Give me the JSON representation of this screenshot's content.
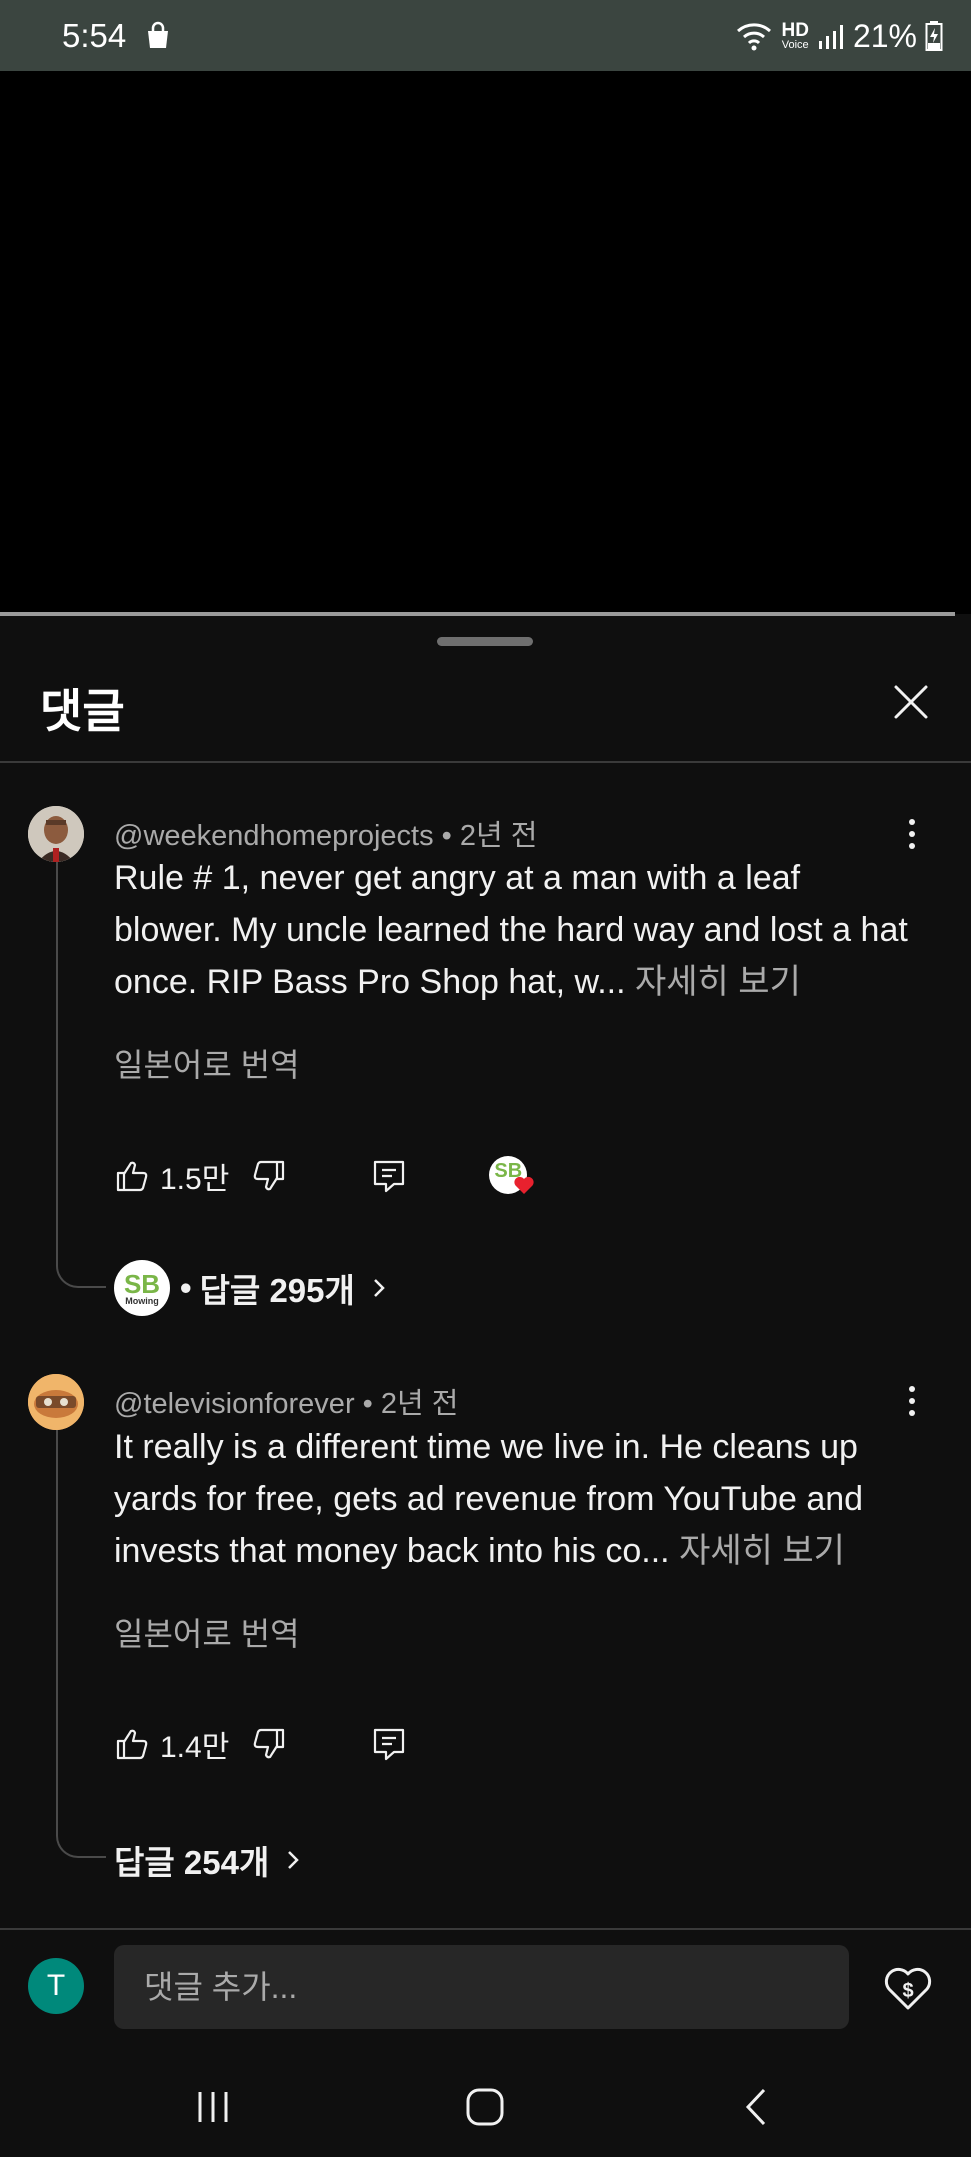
{
  "status_bar": {
    "time": "5:54",
    "battery": "21%",
    "network": "HD",
    "network_sub": "Voice"
  },
  "sheet": {
    "title": "댓글"
  },
  "comments": [
    {
      "handle": "@weekendhomeprojects",
      "age": "2년 전",
      "text": "Rule # 1, never get angry at a man with a leaf blower.  My uncle learned the hard way and lost a hat once.  RIP Bass Pro Shop hat, w...",
      "more": "자세히 보기",
      "translate": "일본어로 번역",
      "likes": "1.5만",
      "creator_heart_badge": "SB",
      "creator_heart_badge_sub": "Mowing",
      "replies_label": "답글 295개"
    },
    {
      "handle": "@televisionforever",
      "age": "2년 전",
      "text": "It really is a different time we live in. He cleans up yards for free, gets ad revenue from YouTube and invests that money back into his co...",
      "more": "자세히 보기",
      "translate": "일본어로 번역",
      "likes": "1.4만",
      "replies_label": "답글 254개"
    }
  ],
  "separator": "•",
  "composer": {
    "avatar_letter": "T",
    "placeholder": "댓글 추가..."
  },
  "icons": {
    "close": "close-icon",
    "like": "thumbs-up-icon",
    "dislike": "thumbs-down-icon",
    "reply": "reply-icon",
    "more": "more-vertical-icon",
    "thanks": "heart-dollar-icon"
  },
  "colors": {
    "background": "#0f0f0f",
    "status_bar": "#3b4540",
    "avatar_t": "#00897b",
    "heart": "#e8212e",
    "sb_green": "#7ab648"
  }
}
